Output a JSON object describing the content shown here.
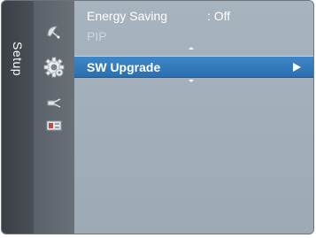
{
  "side_tab": {
    "label": "Setup"
  },
  "icons": [
    {
      "name": "satellite-dish-icon"
    },
    {
      "name": "gear-icon"
    },
    {
      "name": "connector-icon"
    },
    {
      "name": "input-source-icon"
    }
  ],
  "menu": {
    "items": [
      {
        "label": "Energy Saving",
        "value": ": Off",
        "state": "normal"
      },
      {
        "label": "PIP",
        "value": "",
        "state": "disabled"
      },
      {
        "label": "SW Upgrade",
        "value": "",
        "state": "selected"
      }
    ]
  },
  "colors": {
    "selection": "#2f7bbf",
    "panel": "#a3afbb",
    "icon_column": "#626870",
    "side_tab": "#41464c"
  }
}
